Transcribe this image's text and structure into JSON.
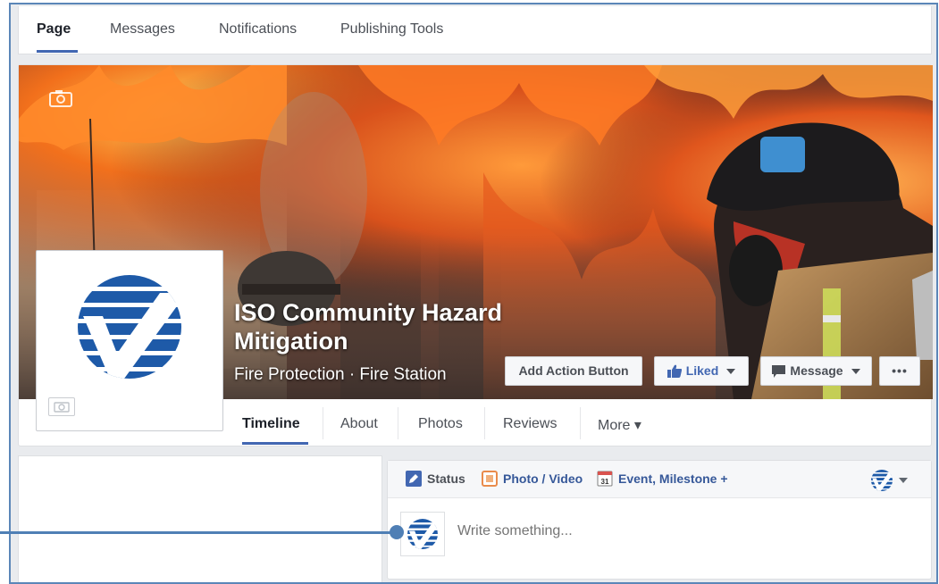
{
  "top_tabs": [
    {
      "label": "Page",
      "active": true
    },
    {
      "label": "Messages",
      "active": false
    },
    {
      "label": "Notifications",
      "active": false
    },
    {
      "label": "Publishing Tools",
      "active": false
    }
  ],
  "page": {
    "name": "ISO Community Hazard Mitigation",
    "category": "Fire Protection · Fire Station"
  },
  "cover_buttons": {
    "add_action": "Add Action Button",
    "liked": "Liked",
    "message": "Message",
    "more": "•••"
  },
  "page_nav": [
    {
      "label": "Timeline",
      "active": true
    },
    {
      "label": "About",
      "active": false
    },
    {
      "label": "Photos",
      "active": false
    },
    {
      "label": "Reviews",
      "active": false
    },
    {
      "label": "More ▾",
      "active": false
    }
  ],
  "composer": {
    "tabs": [
      {
        "label": "Status",
        "icon": "pencil-icon"
      },
      {
        "label": "Photo / Video",
        "icon": "photo-icon"
      },
      {
        "label": "Event, Milestone +",
        "icon": "calendar-icon",
        "icon_text": "31"
      }
    ],
    "placeholder": "Write something..."
  },
  "colors": {
    "accent": "#4267b2",
    "link": "#365899",
    "logo_blue": "#1e5aa8",
    "callout": "#4f7fb5"
  }
}
